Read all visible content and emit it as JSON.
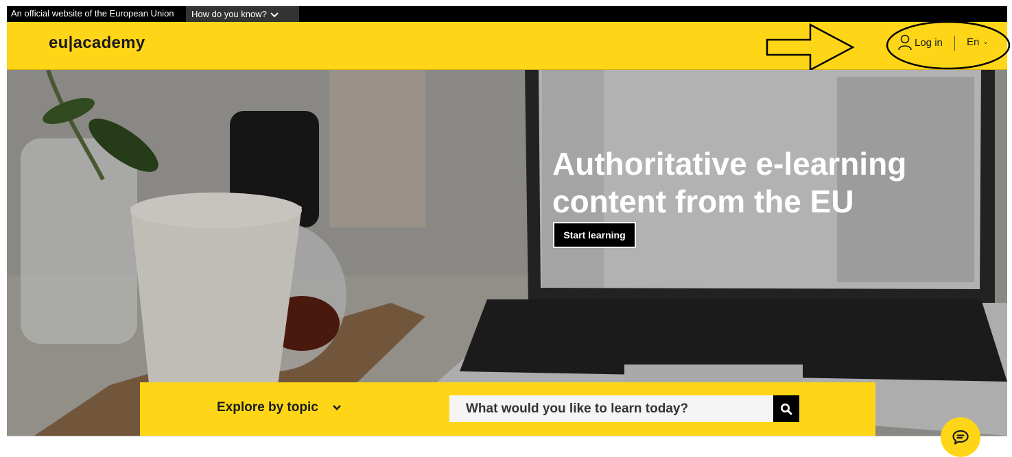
{
  "eu_banner": {
    "official_text": "An official website of the European Union",
    "how_do_you_know": "How do you know?"
  },
  "header": {
    "logo_text": "eu|academy",
    "login_label": "Log in",
    "language": "En",
    "background_color": "#ffd617"
  },
  "hero": {
    "title": "Authoritative e-learning content from the EU",
    "cta_label": "Start learning"
  },
  "search_strip": {
    "explore_label": "Explore by topic",
    "search_placeholder": "What would you like to learn today?"
  },
  "icons": {
    "login": "user-icon",
    "chevron": "chevron-down-icon",
    "search": "search-icon",
    "chat": "chat-icon"
  },
  "annotations": {
    "arrow_color": "#000000",
    "ellipse_color": "#000000"
  }
}
